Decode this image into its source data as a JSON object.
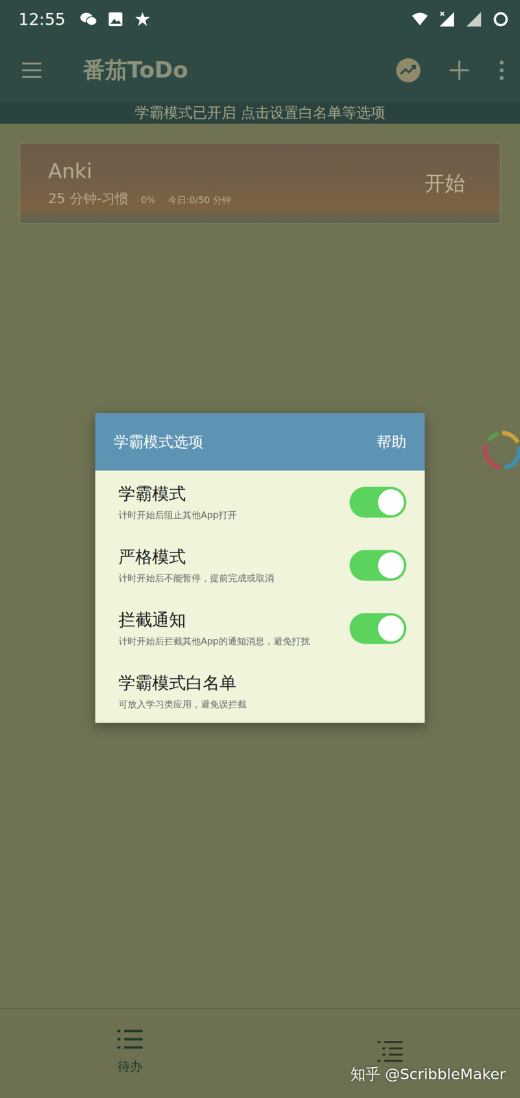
{
  "status_bar": {
    "time": "12:55"
  },
  "app_bar": {
    "title": "番茄ToDo"
  },
  "notice": "学霸模式已开启 点击设置白名单等选项",
  "tasks": [
    {
      "name": "Anki",
      "duration": "25 分钟-习惯",
      "progress": "0%",
      "today": "今日:0/50 分钟",
      "action": "开始"
    }
  ],
  "dialog": {
    "title": "学霸模式选项",
    "help": "帮助",
    "options": [
      {
        "kind": "toggle",
        "label": "学霸模式",
        "description": "计时开始后阻止其他App打开",
        "on": true
      },
      {
        "kind": "toggle",
        "label": "严格模式",
        "description": "计时开始后不能暂停，提前完成或取消",
        "on": true
      },
      {
        "kind": "toggle",
        "label": "拦截通知",
        "description": "计时开始后拦截其他App的通知消息，避免打扰",
        "on": true
      },
      {
        "kind": "link",
        "label": "学霸模式白名单",
        "description": "可放入学习类应用，避免误拦截"
      }
    ]
  },
  "bottom_nav": [
    {
      "label": "待办",
      "selected": true
    },
    {
      "selected": false
    }
  ],
  "watermark": "知乎 @ScribbleMaker"
}
